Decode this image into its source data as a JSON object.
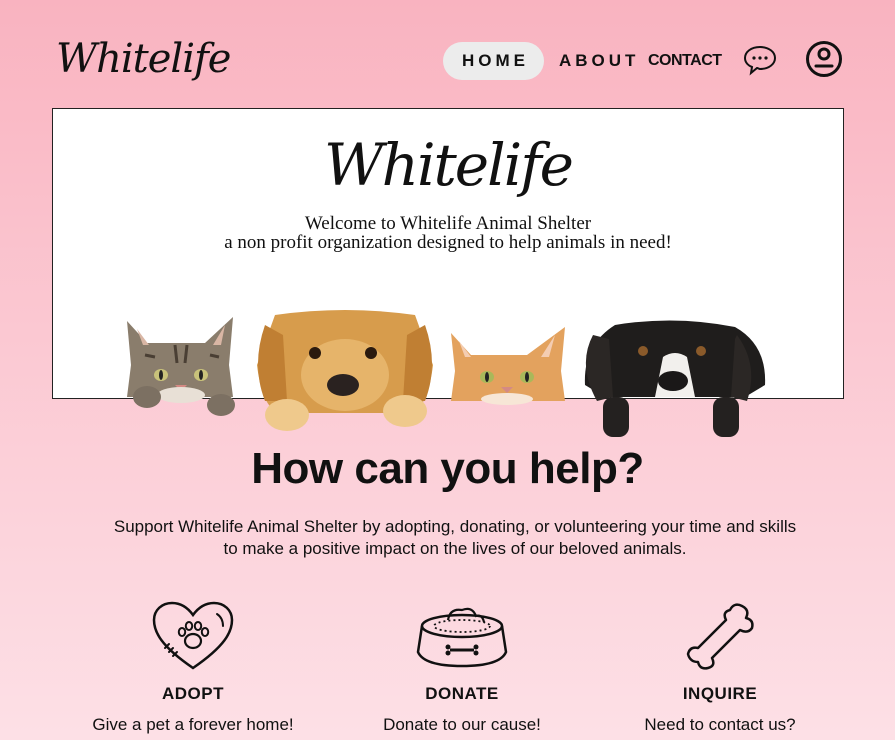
{
  "header": {
    "logo": "Whitelife",
    "nav": [
      {
        "label": "HOME"
      },
      {
        "label": "ABOUT"
      },
      {
        "label": "CONTACT"
      }
    ],
    "icons": [
      "chat-bubble-icon",
      "account-icon"
    ]
  },
  "hero": {
    "title": "Whitelife",
    "line1": "Welcome to Whitelife Animal Shelter",
    "line2": "a non profit organization designed to help animals in need!",
    "animals": [
      "tabby-cat",
      "golden-retriever",
      "orange-cat",
      "black-white-dog"
    ]
  },
  "help": {
    "title": "How can you help?",
    "text": "Support Whitelife Animal Shelter by adopting, donating, or volunteering your time and skills to make a positive impact on the lives of our beloved animals."
  },
  "cards": [
    {
      "icon": "heart-paw-icon",
      "title": "ADOPT",
      "text": "Give a pet a forever home!"
    },
    {
      "icon": "pet-bowl-icon",
      "title": "DONATE",
      "text": "Donate to our cause!"
    },
    {
      "icon": "bone-icon",
      "title": "INQUIRE",
      "text": "Need to contact us?"
    }
  ],
  "colors": {
    "background_top": "#f9b3c0",
    "background_bottom": "#fde0e6",
    "nav_active": "#ececec",
    "text": "#111111"
  }
}
